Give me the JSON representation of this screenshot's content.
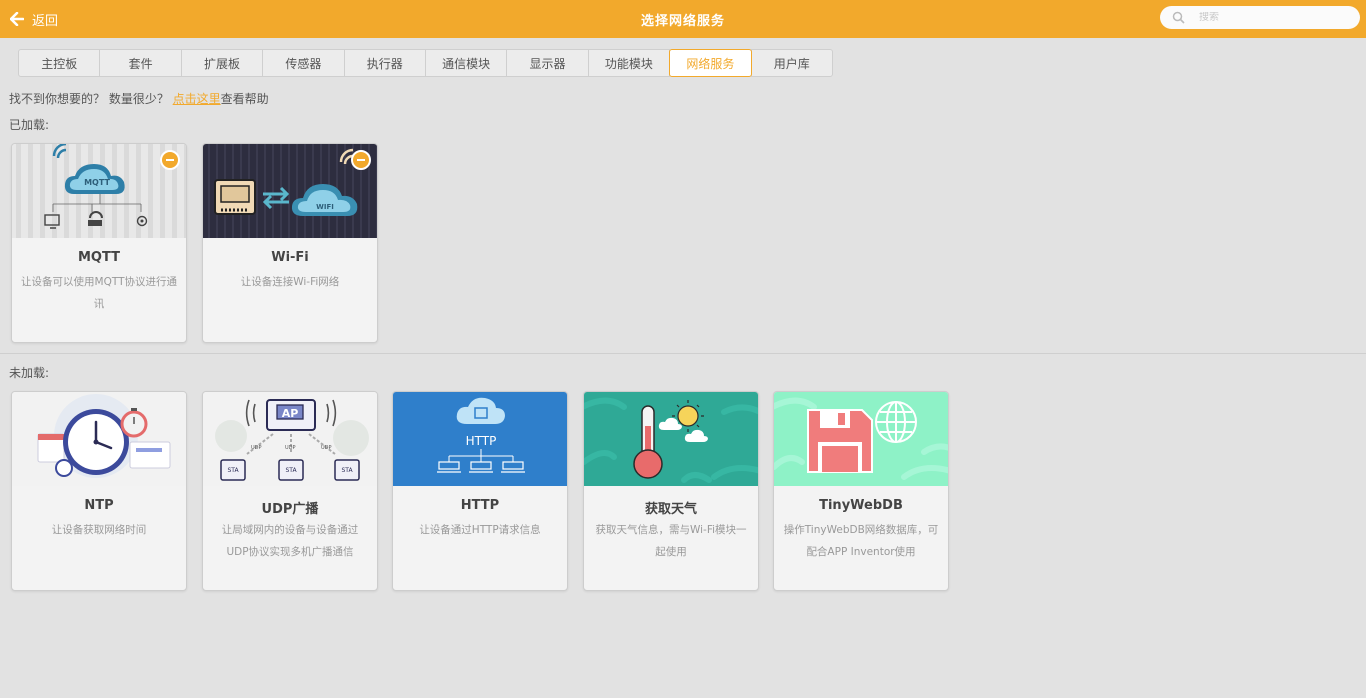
{
  "topbar": {
    "back_label": "返回",
    "title": "选择网络服务",
    "search_placeholder": "搜索"
  },
  "tabs": [
    {
      "label": "主控板"
    },
    {
      "label": "套件"
    },
    {
      "label": "扩展板"
    },
    {
      "label": "传感器"
    },
    {
      "label": "执行器"
    },
    {
      "label": "通信模块"
    },
    {
      "label": "显示器"
    },
    {
      "label": "功能模块"
    },
    {
      "label": "网络服务",
      "active": true
    },
    {
      "label": "用户库"
    }
  ],
  "help": {
    "prefix": "找不到你想要的？ 数量很少？ ",
    "link": "点击这里",
    "suffix": "查看帮助"
  },
  "loaded": {
    "label": "已加载:",
    "cards": [
      {
        "name": "MQTT",
        "desc": "让设备可以使用MQTT协议进行通讯",
        "image_text": "MQTT"
      },
      {
        "name": "Wi-Fi",
        "desc": "让设备连接Wi-Fi网络",
        "image_text": "WIFI"
      }
    ]
  },
  "unloaded": {
    "label": "未加载:",
    "cards": [
      {
        "name": "NTP",
        "desc": "让设备获取网络时间"
      },
      {
        "name": "UDP广播",
        "desc": "让局域网内的设备与设备通过UDP协议实现多机广播通信",
        "image_text": {
          "ap": "AP",
          "sta": "STA",
          "udp": "UDP"
        }
      },
      {
        "name": "HTTP",
        "desc": "让设备通过HTTP请求信息",
        "image_text": "HTTP"
      },
      {
        "name": "获取天气",
        "desc": "获取天气信息，需与Wi-Fi模块一起使用"
      },
      {
        "name": "TinyWebDB",
        "desc": "操作TinyWebDB网络数据库，可配合APP Inventor使用"
      }
    ]
  },
  "colors": {
    "accent": "#f2a92c",
    "http_bg": "#2f7fcb",
    "weather_bg": "#2fa996",
    "tinywebdb_bg": "#8ef2c7"
  }
}
